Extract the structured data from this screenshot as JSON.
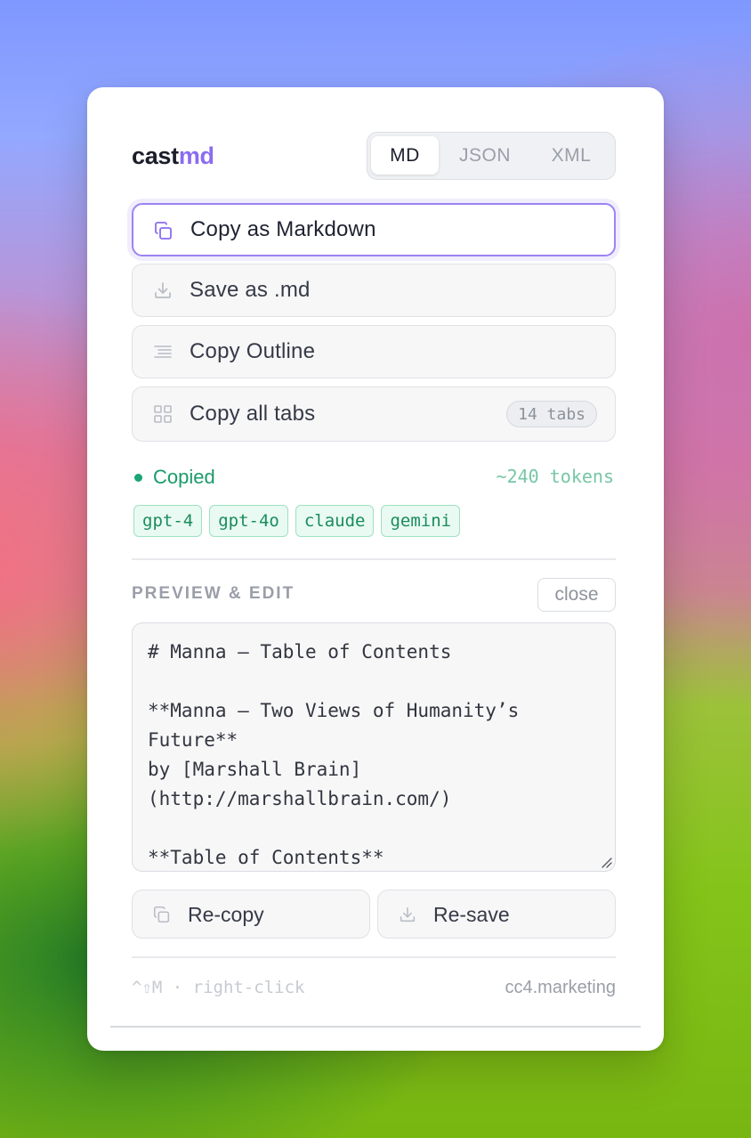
{
  "app": {
    "brand_main": "cast",
    "brand_accent": "md",
    "formats": [
      "MD",
      "JSON",
      "XML"
    ],
    "selected_format": "MD"
  },
  "actions": [
    {
      "label": "Copy as Markdown",
      "icon": "copy-icon",
      "active": true
    },
    {
      "label": "Save as .md",
      "icon": "download-icon"
    },
    {
      "label": "Copy Outline",
      "icon": "outline-lines-icon"
    },
    {
      "label": "Copy all tabs",
      "icon": "grid-icon",
      "badge": "14 tabs"
    }
  ],
  "status": {
    "text": "Copied",
    "tokens": "~240 tokens",
    "models": [
      "gpt-4",
      "gpt-4o",
      "claude",
      "gemini"
    ]
  },
  "preview": {
    "title": "PREVIEW & EDIT",
    "close_label": "close",
    "content": "# Manna — Table of Contents\n\n**Manna – Two Views of Humanity’s Future**\nby [Marshall Brain](http://marshallbrain.com/)\n\n**Table of Contents**"
  },
  "buttons": {
    "recopy": "Re-copy",
    "resave": "Re-save"
  },
  "footer": {
    "hint": "^⇧M · right-click",
    "site": "cc4.marketing"
  },
  "colors": {
    "accent": "#8b6cf0",
    "success": "#199b6a"
  }
}
